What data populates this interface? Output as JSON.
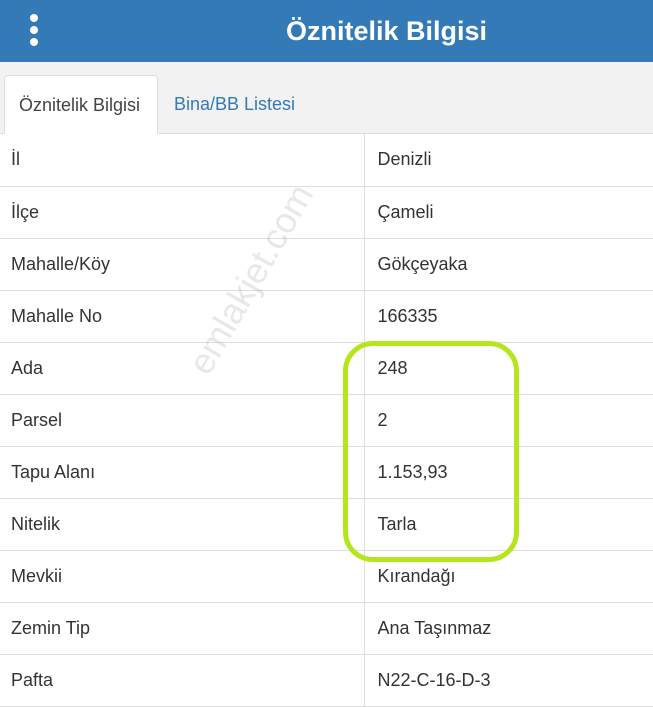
{
  "header": {
    "title": "Öznitelik Bilgisi",
    "menu_icon": "vertical-ellipsis-icon"
  },
  "tabs": [
    {
      "label": "Öznitelik Bilgisi",
      "active": true
    },
    {
      "label": "Bina/BB Listesi",
      "active": false
    }
  ],
  "rows": [
    {
      "label": "İl",
      "value": "Denizli"
    },
    {
      "label": "İlçe",
      "value": "Çameli"
    },
    {
      "label": "Mahalle/Köy",
      "value": "Gökçeyaka"
    },
    {
      "label": "Mahalle No",
      "value": "166335"
    },
    {
      "label": "Ada",
      "value": "248"
    },
    {
      "label": "Parsel",
      "value": "2"
    },
    {
      "label": "Tapu Alanı",
      "value": "1.153,93"
    },
    {
      "label": "Nitelik",
      "value": "Tarla"
    },
    {
      "label": "Mevkii",
      "value": "Kırandağı"
    },
    {
      "label": "Zemin Tip",
      "value": "Ana Taşınmaz"
    },
    {
      "label": "Pafta",
      "value": "N22-C-16-D-3"
    }
  ],
  "watermark": "emlakjet.com",
  "colors": {
    "header_bg": "#337ab7",
    "highlight": "#b5e61d",
    "tab_link": "#337ab7"
  }
}
